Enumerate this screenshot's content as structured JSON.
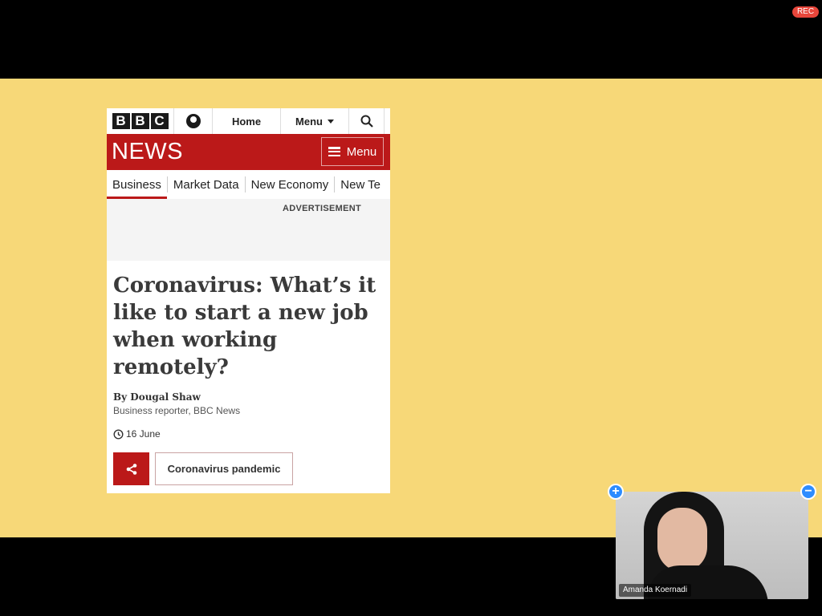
{
  "recording": {
    "label": "REC"
  },
  "bbc": {
    "logo": [
      "B",
      "B",
      "C"
    ],
    "nav": {
      "home": "Home",
      "menu": "Menu"
    }
  },
  "news": {
    "title": "NEWS",
    "menu_label": "Menu",
    "tabs": [
      "Business",
      "Market Data",
      "New Economy",
      "New Te"
    ],
    "ad_label": "ADVERTISEMENT"
  },
  "article": {
    "headline": "Coronavirus: What’s it like to start a new job when working remotely?",
    "byline": "By Dougal Shaw",
    "role": "Business reporter, BBC News",
    "date": "16 June",
    "topic_label": "Coronavirus pandemic"
  },
  "participant": {
    "name": "Amanda Koernadi",
    "add_label": "+",
    "remove_label": "−"
  },
  "colors": {
    "bbc_red": "#bb1919",
    "slide_yellow": "#f7d878",
    "rec_red": "#e8463b",
    "accent_blue": "#2d8cff"
  }
}
